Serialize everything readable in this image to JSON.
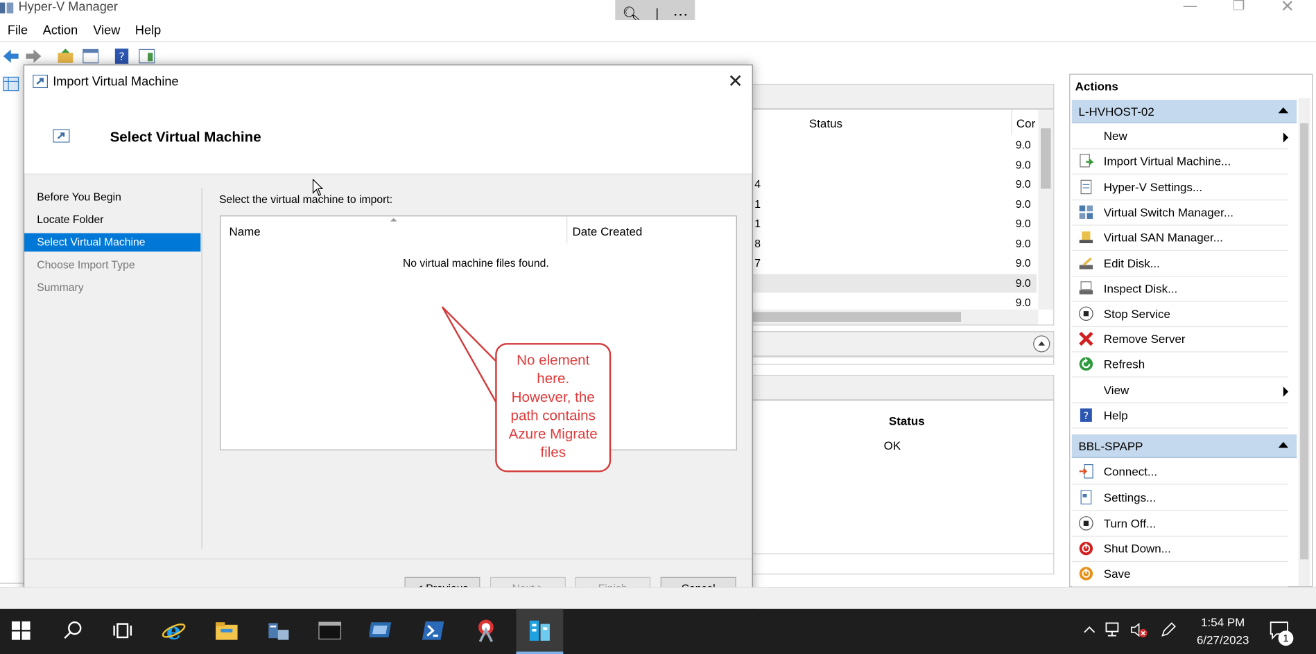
{
  "window": {
    "title": "Hyper-V Manager"
  },
  "menu": [
    "File",
    "Action",
    "View",
    "Help"
  ],
  "vm_grid": {
    "headers": {
      "status": "Status",
      "config": "Cor"
    },
    "config_values": [
      "9.0",
      "9.0",
      "9.0",
      "9.0",
      "9.0",
      "9.0",
      "9.0",
      "9.0",
      "9.0"
    ],
    "partial_left": [
      "4",
      "1",
      "1",
      "8",
      "7"
    ]
  },
  "detail_grid": {
    "status_header": "Status",
    "status_value": "OK"
  },
  "actions": {
    "title": "Actions",
    "group1": {
      "name": "L-HVHOST-02",
      "items": [
        "New",
        "Import Virtual Machine...",
        "Hyper-V Settings...",
        "Virtual Switch Manager...",
        "Virtual SAN Manager...",
        "Edit Disk...",
        "Inspect Disk...",
        "Stop Service",
        "Remove Server",
        "Refresh",
        "View",
        "Help"
      ]
    },
    "group2": {
      "name": "BBL-SPAPP",
      "items": [
        "Connect...",
        "Settings...",
        "Turn Off...",
        "Shut Down...",
        "Save"
      ]
    }
  },
  "dialog": {
    "title": "Import Virtual Machine",
    "heading": "Select Virtual Machine",
    "steps": [
      "Before You Begin",
      "Locate Folder",
      "Select Virtual Machine",
      "Choose Import Type",
      "Summary"
    ],
    "active_step": "Select Virtual Machine",
    "prompt": "Select the virtual machine to import:",
    "columns": {
      "name": "Name",
      "date": "Date Created"
    },
    "empty_message": "No virtual machine files found.",
    "buttons": {
      "previous": "< Previous",
      "next": "Next >",
      "finish": "Finish",
      "cancel": "Cancel"
    }
  },
  "callout": {
    "line1": "No element",
    "line2": "here.",
    "line3": "However, the",
    "line4": "path contains",
    "line5": "Azure Migrate",
    "line6": "files"
  },
  "taskbar": {
    "time": "1:54 PM",
    "date": "6/27/2023",
    "notification_count": "1"
  },
  "colors": {
    "accent": "#0078d7",
    "callout_red": "#d33b3b",
    "actions_group": "#c5d9ee"
  }
}
